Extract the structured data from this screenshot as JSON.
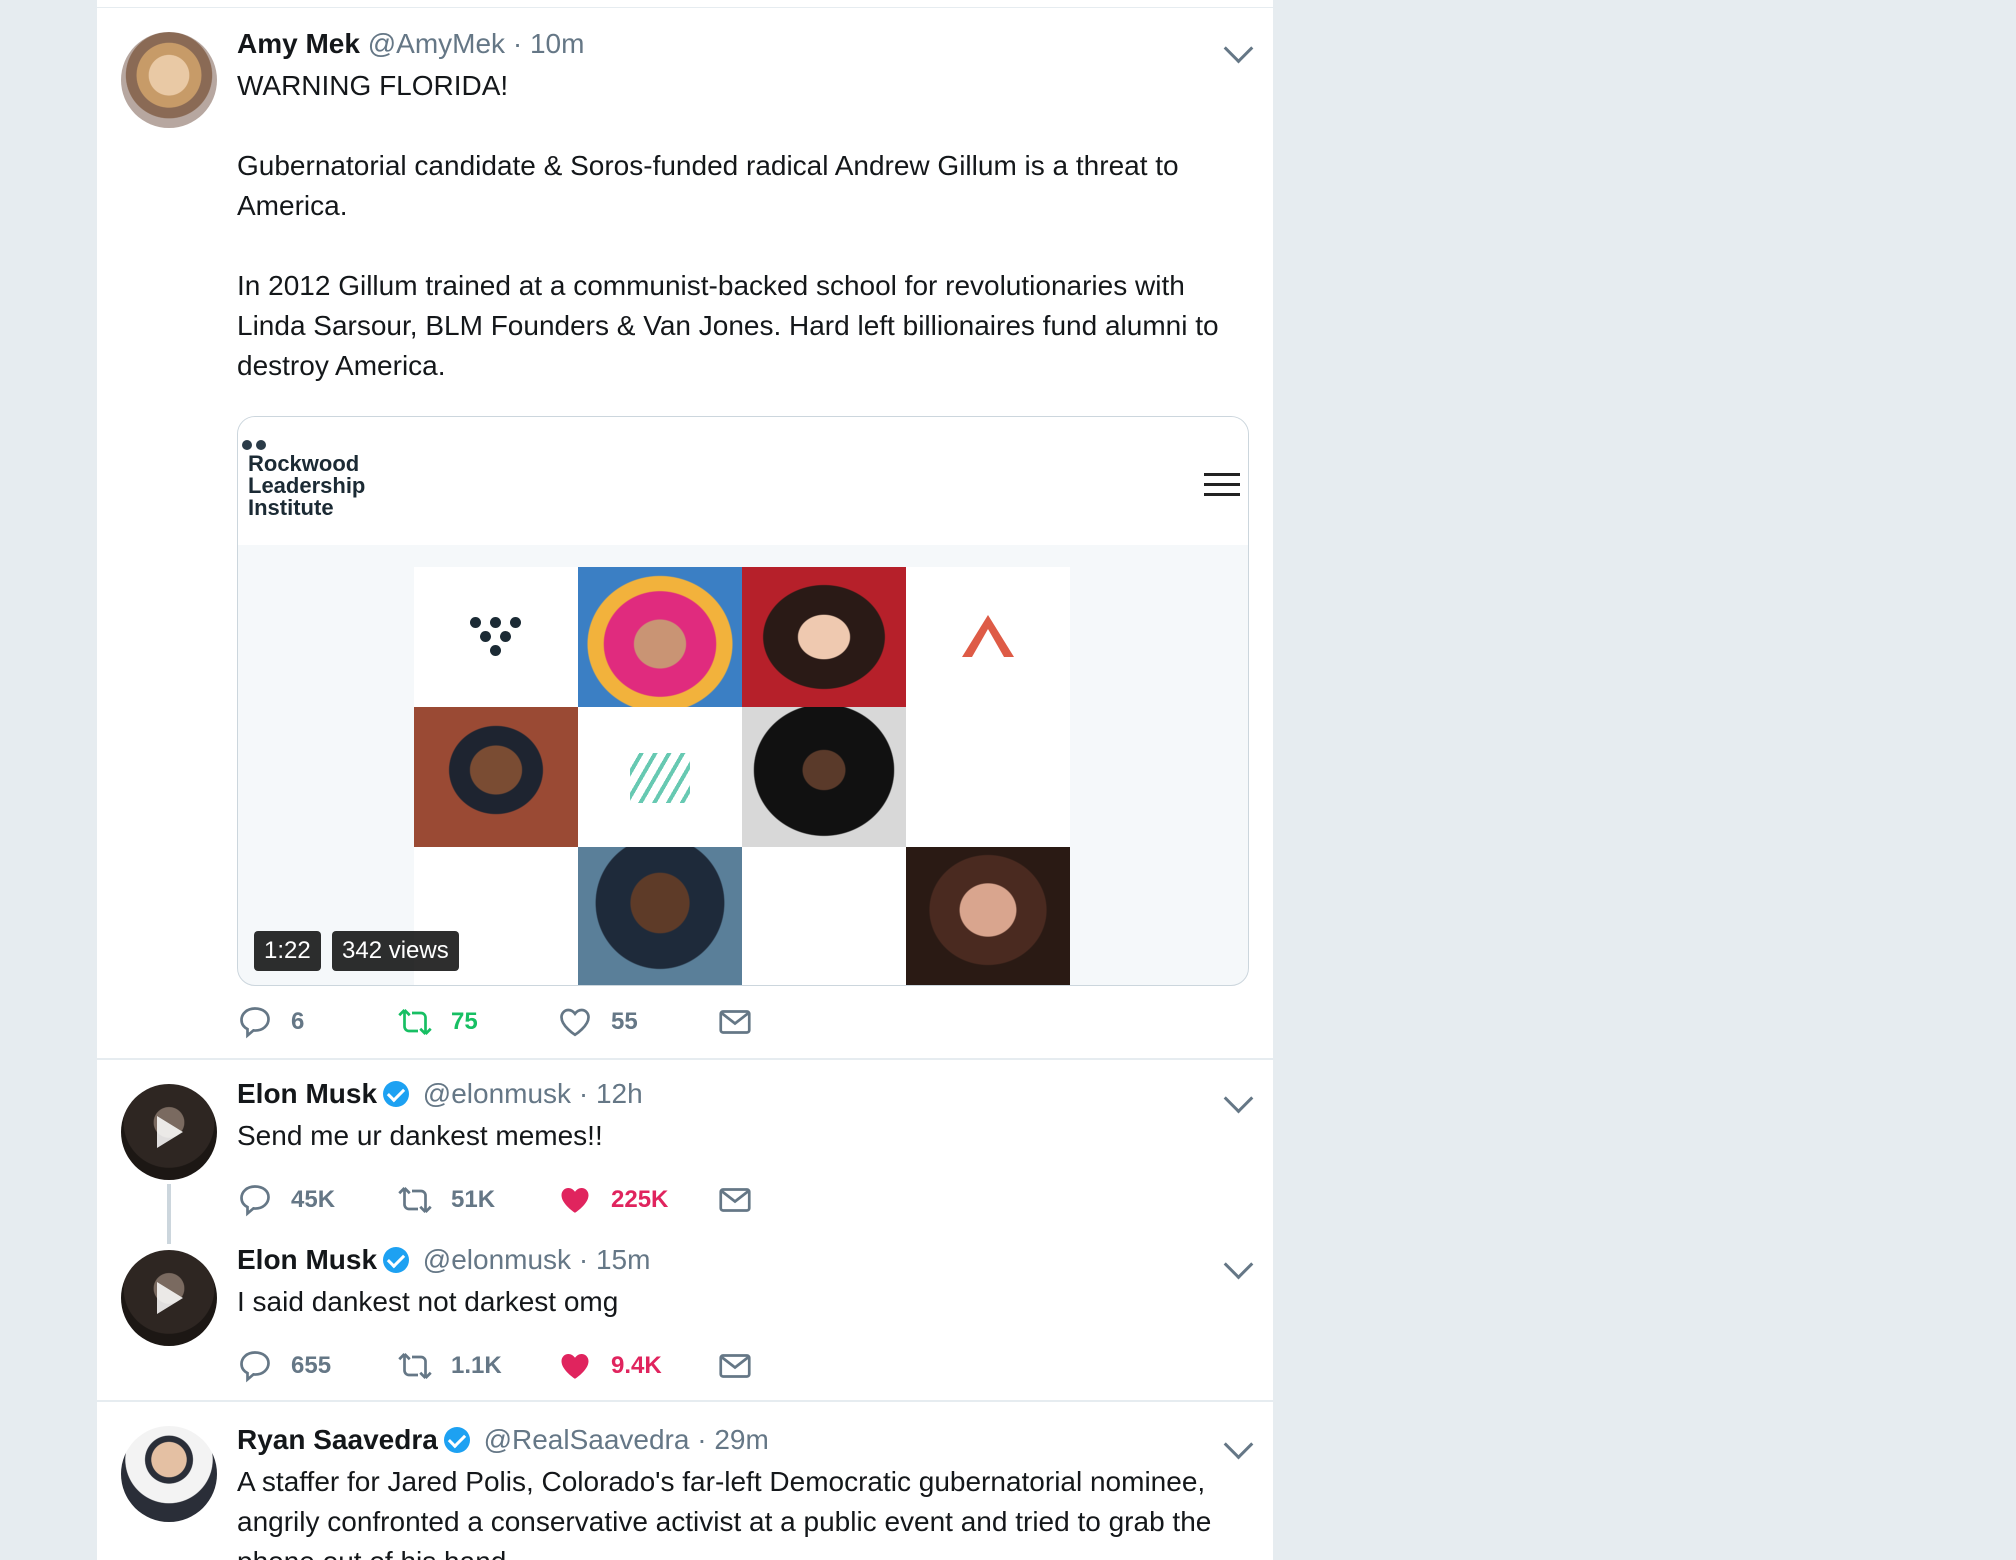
{
  "tweets": [
    {
      "name": "Amy Mek",
      "handle": "@AmyMek",
      "time": "10m",
      "text": "WARNING FLORIDA!\n\nGubernatorial candidate & Soros-funded radical Andrew Gillum is a threat to America.\n\nIn 2012 Gillum trained at a communist-backed school for revolutionaries with Linda Sarsour, BLM Founders & Van Jones. Hard left billionaires fund alumni to destroy America.",
      "media": {
        "site_logo": "Rockwood\nLeadership\nInstitute",
        "duration": "1:22",
        "views": "342 views"
      },
      "replies": "6",
      "retweets": "75",
      "likes": "55"
    },
    {
      "name": "Elon Musk",
      "handle": "@elonmusk",
      "time": "12h",
      "text": "Send me ur dankest memes!!",
      "replies": "45K",
      "retweets": "51K",
      "likes": "225K"
    },
    {
      "name": "Elon Musk",
      "handle": "@elonmusk",
      "time": "15m",
      "text": "I said dankest not darkest omg",
      "replies": "655",
      "retweets": "1.1K",
      "likes": "9.4K"
    },
    {
      "name": "Ryan Saavedra",
      "handle": "@RealSaavedra",
      "time": "29m",
      "text": "A staffer for Jared Polis, Colorado's far-left Democratic gubernatorial nominee, angrily confronted a conservative activist at a public event and tried to grab the phone out of his hand."
    }
  ],
  "separator": "·",
  "colors": {
    "retweet_active": "#17bf63",
    "like_active": "#e0245e",
    "verified": "#1da1f2",
    "muted": "#657786",
    "background": "#e6ecf0"
  },
  "icons": [
    "reply-icon",
    "retweet-icon",
    "like-icon",
    "direct-message-icon",
    "chevron-down-icon",
    "verified-icon"
  ]
}
